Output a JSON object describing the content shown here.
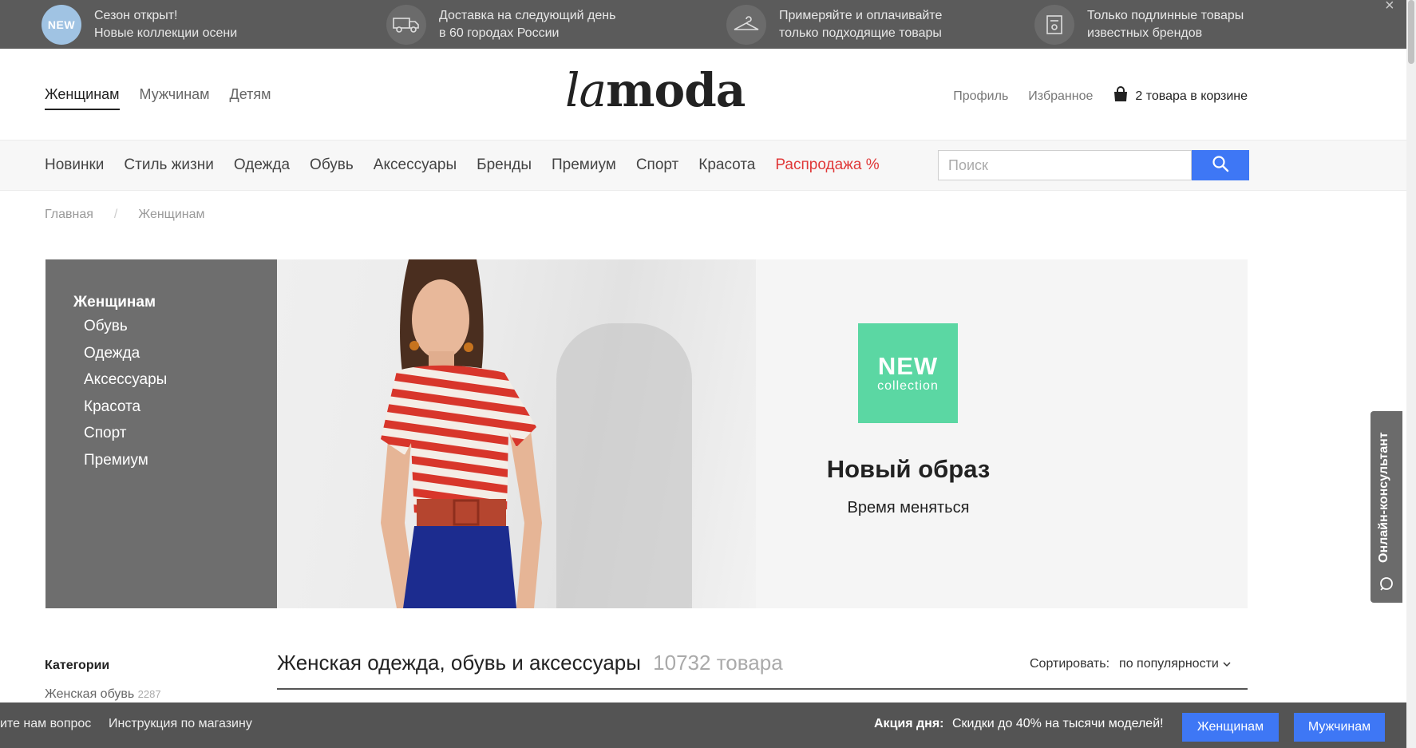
{
  "promo_bar": {
    "items": [
      {
        "badge": "NEW",
        "line1": "Сезон открыт!",
        "line2": "Новые коллекции осени"
      },
      {
        "icon": "truck-icon",
        "line1": "Доставка на следующий день",
        "line2": "в 60 городах России"
      },
      {
        "icon": "hanger-icon",
        "line1": "Примеряйте и оплачивайте",
        "line2": "только подходящие товары"
      },
      {
        "icon": "tag-icon",
        "line1": "Только подлинные товары",
        "line2": "известных брендов"
      }
    ],
    "close": "×"
  },
  "header": {
    "gender_nav": [
      "Женщинам",
      "Мужчинам",
      "Детям"
    ],
    "logo_la": "la",
    "logo_moda": "moda",
    "profile": "Профиль",
    "favorites": "Избранное",
    "cart": "2 товара в корзине"
  },
  "category_nav": {
    "items": [
      "Новинки",
      "Стиль жизни",
      "Одежда",
      "Обувь",
      "Аксессуары",
      "Бренды",
      "Премиум",
      "Спорт",
      "Красота"
    ],
    "sale": "Распродажа %",
    "search_placeholder": "Поиск"
  },
  "breadcrumb": {
    "home": "Главная",
    "separator": "/",
    "current": "Женщинам"
  },
  "hero": {
    "menu_title": "Женщинам",
    "menu_items": [
      "Обувь",
      "Одежда",
      "Аксессуары",
      "Красота",
      "Спорт",
      "Премиум"
    ],
    "badge_line1": "NEW",
    "badge_line2": "collection",
    "title": "Новый образ",
    "subtitle": "Время меняться"
  },
  "listing": {
    "sidebar_title": "Категории",
    "sidebar_item": "Женская обувь",
    "sidebar_item_count": "2287",
    "title": "Женская одежда, обувь и аксессуары",
    "count": "10732 товара",
    "sort_label": "Сортировать:",
    "sort_value": "по популярности"
  },
  "bottom_bar": {
    "ask": "ите нам вопрос",
    "instruction": "Инструкция по магазину",
    "promo_label": "Акция дня:",
    "promo_text": "Скидки до 40% на тысячи моделей!",
    "btn_women": "Женщинам",
    "btn_men": "Мужчинам"
  },
  "consultant": {
    "label": "Онлайн-консультант"
  },
  "colors": {
    "accent": "#3e77f5",
    "sale": "#e03838",
    "badge_new": "#5bd7a3",
    "promo_bar": "#5b5b5b"
  }
}
